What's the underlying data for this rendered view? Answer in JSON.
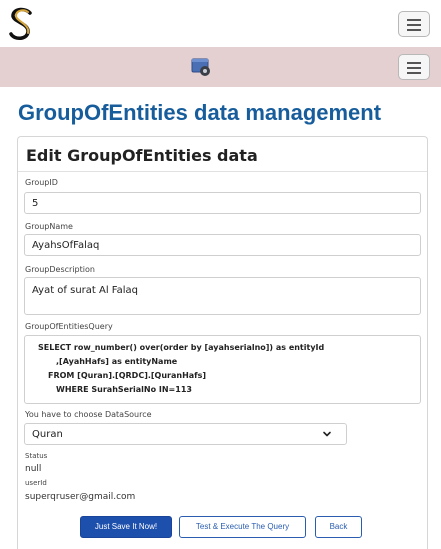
{
  "header": {
    "logo_icon": "stylized-s-logo",
    "menu_icon": "hamburger-icon"
  },
  "subheader": {
    "app_icon": "settings-gear-window-icon",
    "menu_icon": "hamburger-icon"
  },
  "page": {
    "title": "GroupOfEntities data management"
  },
  "form": {
    "title": "Edit GroupOfEntities data",
    "group_id": {
      "label": "GroupID",
      "value": "5"
    },
    "group_name": {
      "label": "GroupName",
      "value": "AyahsOfFalaq"
    },
    "group_description": {
      "label": "GroupDescription",
      "value": "Ayat of surat Al Falaq"
    },
    "query": {
      "label": "GroupOfEntitiesQuery",
      "lines": [
        "SELECT row_number() over(order by [ayahserialno]) as entityId",
        ",[AyahHafs] as entityName",
        "FROM [Quran].[QRDC].[QuranHafs]",
        "WHERE SurahSerialNo IN=113"
      ]
    },
    "datasource": {
      "label": "You have to choose DataSource",
      "selected": "Quran",
      "icon": "chevron-down-icon"
    },
    "status": {
      "label": "Status",
      "value": "null"
    },
    "user": {
      "label": "userId",
      "value": "superqruser@gmail.com"
    }
  },
  "buttons": {
    "save": "Just Save It Now!",
    "test": "Test & Execute The Query",
    "back": "Back"
  },
  "colors": {
    "title_blue": "#175d9c",
    "subbar_bg": "#e5d0d1",
    "primary_button": "#1d4fad",
    "logo_gold": "#d7a63a"
  }
}
